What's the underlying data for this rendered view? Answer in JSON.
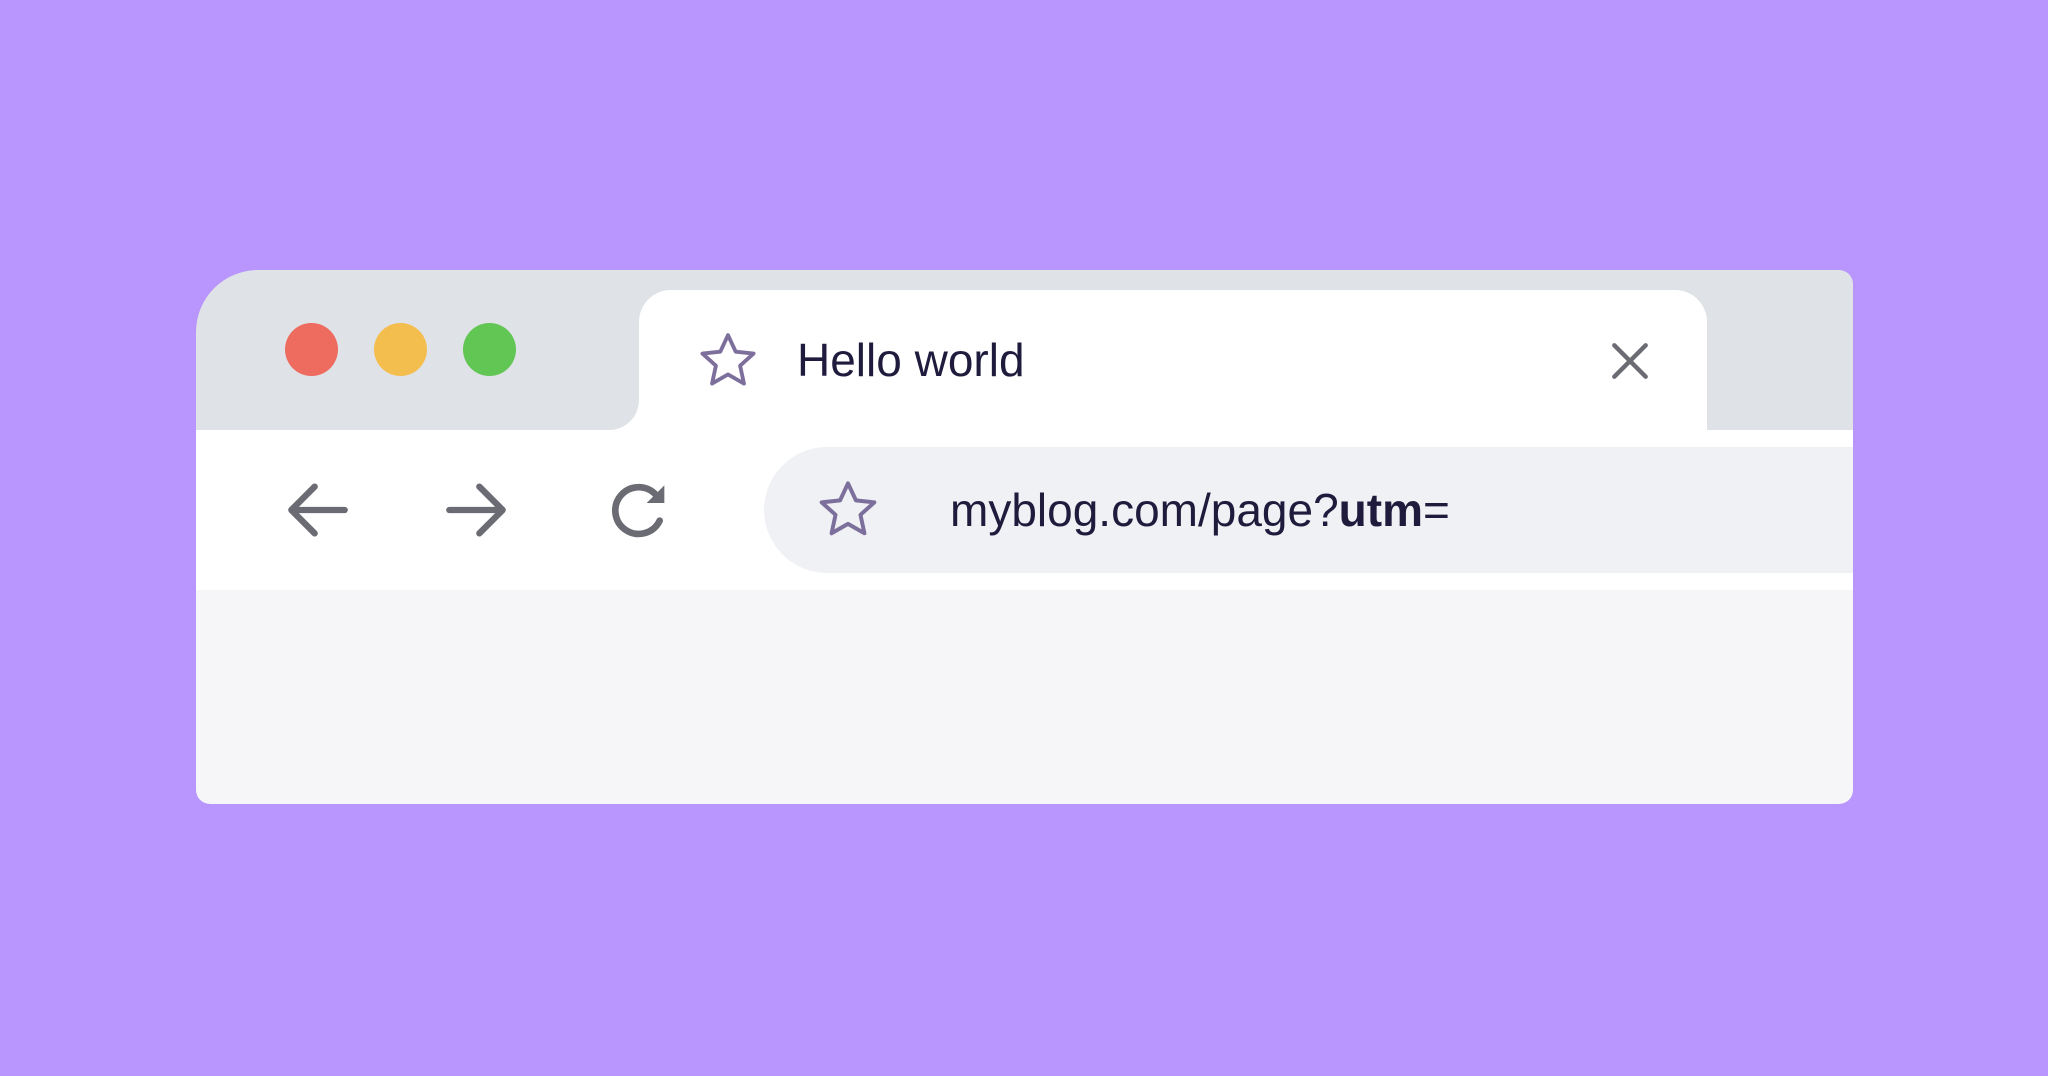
{
  "window": {
    "traffic_lights": [
      {
        "name": "close",
        "color": "#ee6b5f"
      },
      {
        "name": "minimize",
        "color": "#f4be4f"
      },
      {
        "name": "maximize",
        "color": "#62c655"
      }
    ]
  },
  "tab": {
    "title": "Hello world",
    "icon": "star-icon",
    "close_icon": "close-icon"
  },
  "toolbar": {
    "back_icon": "arrow-left-icon",
    "forward_icon": "arrow-right-icon",
    "reload_icon": "reload-icon"
  },
  "omnibox": {
    "icon": "star-icon",
    "url_plain": "myblog.com/page?",
    "url_bold": "utm",
    "url_suffix": "="
  },
  "colors": {
    "background": "#b896fe",
    "titlebar": "#dfe2e6",
    "tab": "#ffffff",
    "omnibox": "#f0f1f4",
    "content": "#f6f6f9",
    "text": "#1e1b3d",
    "icon_gray": "#6b6b73",
    "star_outline": "#7d6f9c"
  }
}
